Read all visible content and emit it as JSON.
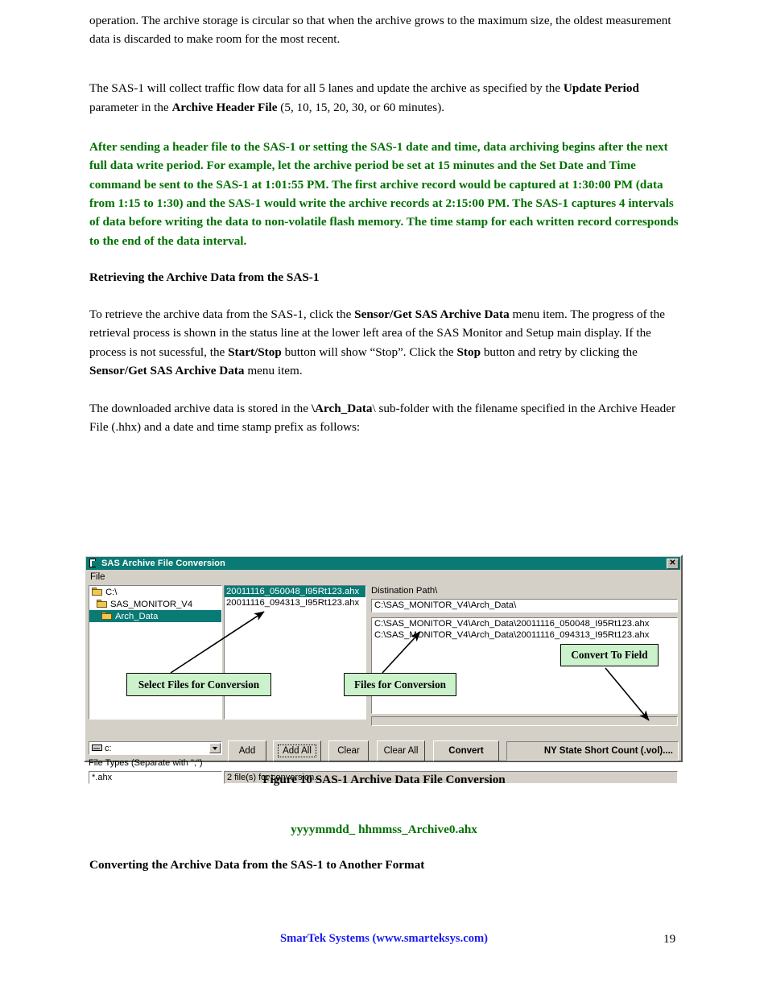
{
  "document": {
    "paragraph_1": "operation.  The archive storage is circular so that when the archive grows to the maximum size, the oldest measurement data is discarded to make room for the most recent.",
    "paragraph_2_part1": "The SAS-1 will collect traffic flow data for all 5 lanes and update the archive as specified by the ",
    "paragraph_2_bold1": "Update Period",
    "paragraph_2_part2": " parameter in the ",
    "paragraph_2_bold2": "Archive Header File",
    "paragraph_2_part3": " (5, 10, 15, 20, 30, or 60 minutes).",
    "green_paragraph": "After sending a header file to the SAS-1 or setting the SAS-1 date and time, data archiving begins after the next full data write period.  For example, let the archive period be set at 15 minutes and the Set Date and Time command be sent to the SAS-1 at 1:01:55 PM.  The first archive record would be captured at 1:30:00 PM (data from 1:15 to 1:30) and the SAS-1 would write the archive records at 2:15:00 PM.  The SAS-1 captures 4 intervals of data before writing the data to non-volatile flash memory.  The time stamp for each written record corresponds to the end of the data interval.",
    "heading_retrieving": "Retrieving the Archive Data from the SAS-1",
    "paragraph_3_part1": "To retrieve the archive data from the SAS-1, click the ",
    "paragraph_3_bold1": "Sensor/Get SAS Archive Data",
    "paragraph_3_part2": " menu item.  The progress of the retrieval process is shown in the status line at the lower left area of the SAS Monitor and Setup main display.  If the process is not sucessful, the ",
    "paragraph_3_bold2": "Start/Stop",
    "paragraph_3_part3": " button will show “Stop”.  Click the ",
    "paragraph_3_bold3": "Stop",
    "paragraph_3_part4": " button and retry by clicking the ",
    "paragraph_3_bold4": "Sensor/Get SAS Archive Data",
    "paragraph_3_part5": " menu item.",
    "paragraph_4_part1": "The downloaded archive data is stored in the ",
    "paragraph_4_bold1": "\\Arch_Data",
    "paragraph_4_part2": "\\ sub-folder with the filename specified in the Archive Header File (.hhx) and a date and time stamp prefix as follows:",
    "figure_caption": "Figure 10 SAS-1 Archive Data File Conversion",
    "filename_pattern": "yyyymmdd_ hhmmss_Archive0.ahx",
    "heading_converting": "Converting the Archive Data from the SAS-1 to Another Format",
    "footer": "SmarTek Systems (www.smarteksys.com)",
    "page_number": "19"
  },
  "dialog": {
    "title": "SAS Archive File Conversion",
    "title_icon": "document-arrow-icon",
    "close_label": "✕",
    "menu": [
      {
        "label": "File"
      }
    ],
    "tree": {
      "items": [
        {
          "label": "C:\\",
          "level": 0,
          "selected": false,
          "icon": "folder-icon"
        },
        {
          "label": "SAS_MONITOR_V4",
          "level": 1,
          "selected": false,
          "icon": "folder-icon"
        },
        {
          "label": "Arch_Data",
          "level": 2,
          "selected": true,
          "icon": "folder-open-icon"
        }
      ]
    },
    "file_list": {
      "items": [
        {
          "label": "20011116_050048_I95Rt123.ahx",
          "selected": true
        },
        {
          "label": "20011116_094313_I95Rt123.ahx",
          "selected": false
        }
      ]
    },
    "destination": {
      "label": "Distination Path\\",
      "path_value": "C:\\SAS_MONITOR_V4\\Arch_Data\\",
      "files": [
        "C:\\SAS_MONITOR_V4\\Arch_Data\\20011116_050048_I95Rt123.ahx",
        "C:\\SAS_MONITOR_V4\\Arch_Data\\20011116_094313_I95Rt123.ahx"
      ]
    },
    "drive_combo": {
      "value": "c:",
      "icon": "drive-icon"
    },
    "file_types": {
      "label": "File Types (Separate with \";\")",
      "value": "*.ahx"
    },
    "status": "2 file(s) for conversion...",
    "buttons": {
      "add": "Add",
      "add_all": "Add All",
      "clear": "Clear",
      "clear_all": "Clear All",
      "convert": "Convert"
    },
    "convert_to_field": "NY State Short Count (.vol)...."
  },
  "annotations": {
    "select_files": "Select Files for Conversion",
    "files_for_conversion": "Files for Conversion",
    "convert_to_field": "Convert To Field"
  },
  "colors": {
    "green_text": "#007000",
    "footer_blue": "#1a1aee",
    "titlebar_teal": "#0a7a74",
    "dialog_face": "#d4d0c8",
    "callout_green": "#ccf2cc"
  }
}
